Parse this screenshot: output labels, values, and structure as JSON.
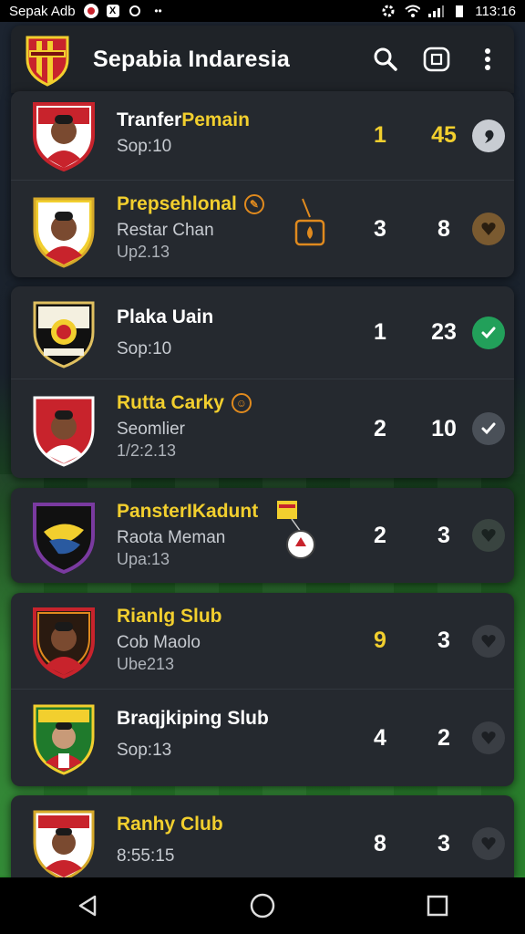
{
  "status_bar": {
    "carrier": "Sepak Adb",
    "time": "113:16"
  },
  "app": {
    "title": "Sepabia Indaresia"
  },
  "colors": {
    "accent_yellow": "#f2cf2e",
    "check_green": "#22a05a",
    "card_bg": "#25292f"
  },
  "groups": [
    {
      "rows": [
        {
          "name": "Tranfer Pemain",
          "name_color": "split",
          "name_a": "Tranfer ",
          "name_b": "Pemain",
          "sub": "Sop:10",
          "sub2": "",
          "n1": "1",
          "n2": "45",
          "n_color": "yellow",
          "status": "comment"
        },
        {
          "name": "Prepsehlonal",
          "sub": "Restar Chan",
          "sub2": "Up2.13",
          "n1": "3",
          "n2": "8",
          "n_color": "white",
          "status": "heart-brown"
        }
      ]
    },
    {
      "rows": [
        {
          "name": "Plaka Uain",
          "sub": "Sop:10",
          "sub2": "",
          "n1": "1",
          "n2": "23",
          "status": "check-green"
        },
        {
          "name": "Rutta Carky",
          "sub": "Seomlier",
          "sub2": "1/2:2.13",
          "n1": "2",
          "n2": "10",
          "status": "check-gray"
        }
      ]
    },
    {
      "rows": [
        {
          "name": "PansterIKadunt",
          "sub": "Raota Meman",
          "sub2": "Upa:13",
          "n1": "2",
          "n2": "3",
          "status": "heart-dark"
        }
      ]
    },
    {
      "rows": [
        {
          "name": "Rianlg Slub",
          "sub": "Cob Maolo",
          "sub2": "Ube213",
          "n1": "9",
          "n2": "3",
          "status": "heart-gray"
        },
        {
          "name": "Braqjkiping Slub",
          "sub": "Sop:13",
          "sub2": "",
          "n1": "4",
          "n2": "2",
          "status": "heart-gray"
        }
      ]
    },
    {
      "rows": [
        {
          "name": "Ranhy Club",
          "sub": "8:55:15",
          "sub2": "",
          "n1": "8",
          "n2": "3",
          "status": "heart-gray"
        }
      ]
    }
  ]
}
